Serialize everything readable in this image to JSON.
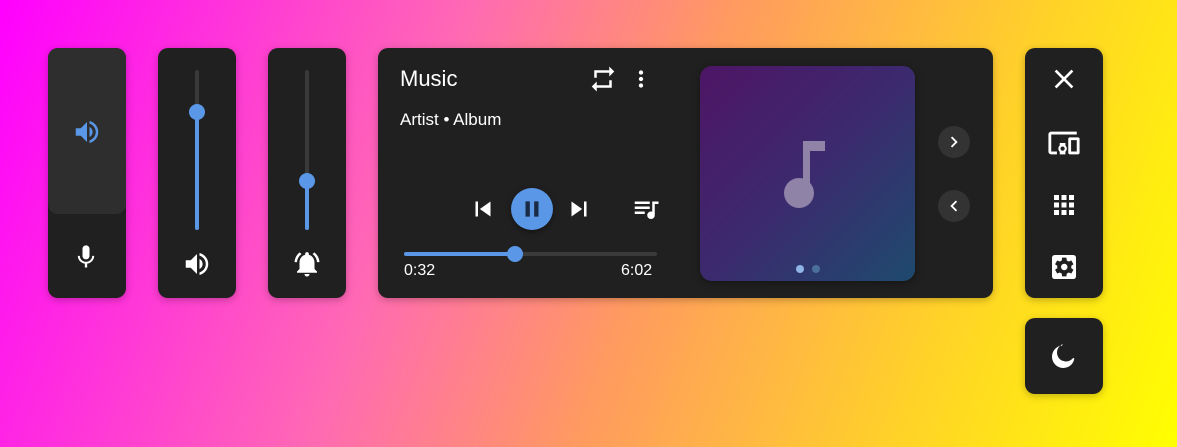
{
  "colors": {
    "panel_bg": "#202020",
    "accent": "#5a97e6",
    "text": "#ffffff",
    "track": "#3a3a3a"
  },
  "quick_panels": {
    "output": {
      "speaker_icon": "speaker-icon",
      "mic_icon": "microphone-icon"
    },
    "media_volume": {
      "level": 0.79,
      "icon": "speaker-icon"
    },
    "notification_volume": {
      "level": 0.37,
      "icon": "bell-icon"
    }
  },
  "media_player": {
    "title": "Music",
    "subtitle": "Artist • Album",
    "elapsed": "0:32",
    "duration": "6:02",
    "progress": 0.44,
    "album_art_icon": "music-note-icon",
    "page_dots": 2,
    "active_page": 0
  },
  "side_menu": {
    "items": [
      "close-icon",
      "devices-icon",
      "apps-grid-icon",
      "settings-icon"
    ],
    "extra": "night-mode-icon"
  }
}
